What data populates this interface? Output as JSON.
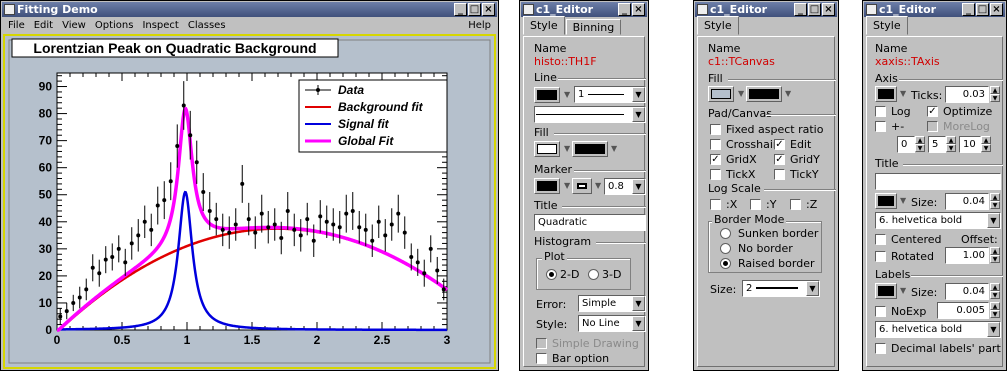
{
  "main_window": {
    "title": "Fitting Demo",
    "menu": [
      "File",
      "Edit",
      "View",
      "Options",
      "Inspect",
      "Classes"
    ],
    "help": "Help"
  },
  "plot": {
    "title": "Lorentzian Peak on Quadratic Background",
    "legend": [
      "Data",
      "Background fit",
      "Signal fit",
      "Global Fit"
    ],
    "colors": {
      "data": "#000000",
      "background": "#e00000",
      "signal": "#0000dd",
      "global": "#ff00ff",
      "frame": "#d6d600",
      "canvas": "#b5c0cc"
    }
  },
  "chart_data": {
    "type": "scatter",
    "title": "Lorentzian Peak on Quadratic Background",
    "xlabel": "",
    "ylabel": "",
    "xlim": [
      0,
      3
    ],
    "ylim": [
      0,
      95
    ],
    "xticks": [
      "0",
      "0.5",
      "1",
      "1.5",
      "2",
      "2.5",
      "3"
    ],
    "yticks": [
      "0",
      "10",
      "20",
      "30",
      "40",
      "50",
      "60",
      "70",
      "80",
      "90"
    ],
    "grid": false,
    "legend_position": "top-right",
    "series": [
      {
        "name": "Data",
        "type": "errorbar",
        "x": [
          0.025,
          0.075,
          0.125,
          0.175,
          0.225,
          0.275,
          0.325,
          0.375,
          0.425,
          0.475,
          0.525,
          0.575,
          0.625,
          0.675,
          0.725,
          0.775,
          0.825,
          0.875,
          0.925,
          0.975,
          1.025,
          1.075,
          1.125,
          1.175,
          1.225,
          1.275,
          1.325,
          1.375,
          1.425,
          1.475,
          1.525,
          1.575,
          1.625,
          1.675,
          1.725,
          1.775,
          1.825,
          1.875,
          1.925,
          1.975,
          2.025,
          2.075,
          2.125,
          2.175,
          2.225,
          2.275,
          2.325,
          2.375,
          2.425,
          2.475,
          2.525,
          2.575,
          2.625,
          2.675,
          2.725,
          2.775,
          2.825,
          2.875,
          2.925,
          2.975
        ],
        "y": [
          5,
          7,
          10,
          12,
          15,
          23,
          21,
          26,
          27,
          30,
          25,
          32,
          35,
          40,
          37,
          46,
          48,
          55,
          68,
          83,
          72,
          62,
          51,
          44,
          41,
          37,
          36,
          39,
          54,
          41,
          36,
          43,
          38,
          39,
          34,
          44,
          37,
          35,
          41,
          33,
          42,
          40,
          39,
          38,
          43,
          44,
          38,
          37,
          33,
          40,
          35,
          39,
          43,
          36,
          27,
          25,
          21,
          30,
          22,
          15
        ],
        "yerr": [
          3,
          3,
          3,
          4,
          4,
          5,
          5,
          5,
          5,
          5,
          5,
          6,
          6,
          6,
          6,
          7,
          7,
          7,
          8,
          9,
          9,
          8,
          7,
          7,
          6,
          6,
          6,
          6,
          7,
          6,
          6,
          7,
          6,
          6,
          6,
          7,
          6,
          6,
          6,
          6,
          6,
          6,
          6,
          6,
          7,
          7,
          6,
          6,
          6,
          6,
          6,
          6,
          7,
          6,
          5,
          5,
          5,
          5,
          5,
          4
        ]
      },
      {
        "name": "Background fit",
        "type": "line",
        "formula": "-0.78 + 45.1*x - 13.3*x^2"
      },
      {
        "name": "Signal fit",
        "type": "line",
        "formula": "Lorentzian amplitude 51, mean 0.987, width 0.13"
      },
      {
        "name": "Global Fit",
        "type": "line",
        "formula": "Background + Signal"
      }
    ]
  },
  "editor1": {
    "title": "c1_Editor",
    "tabs": [
      "Style",
      "Binning"
    ],
    "name_label": "Name",
    "name_value": "histo::TH1F",
    "line_label": "Line",
    "line_width": "1",
    "fill_label": "Fill",
    "marker_label": "Marker",
    "marker_size": "0.8",
    "title_label": "Title",
    "title_value": "Quadratic Background",
    "histogram_label": "Histogram",
    "plot_label": "Plot",
    "plot_2d": "2-D",
    "plot_3d": "3-D",
    "error_label": "Error:",
    "error_value": "Simple",
    "style_label": "Style:",
    "style_value": "No Line",
    "simple_drawing": "Simple Drawing",
    "bar_option": "Bar option"
  },
  "editor2": {
    "title": "c1_Editor",
    "tab": "Style",
    "name_label": "Name",
    "name_value": "c1::TCanvas",
    "fill_label": "Fill",
    "padcanvas_label": "Pad/Canvas",
    "fixed_aspect": "Fixed aspect ratio",
    "crosshair": "Crosshair",
    "edit": "Edit",
    "gridx": "GridX",
    "gridy": "GridY",
    "tickx": "TickX",
    "ticky": "TickY",
    "logscale_label": "Log Scale",
    "logx": ":X",
    "logy": ":Y",
    "logz": ":Z",
    "bordermode_label": "Border Mode",
    "sunken": "Sunken border",
    "noborder": "No border",
    "raised": "Raised border",
    "size_label": "Size:",
    "size_value": "2"
  },
  "editor3": {
    "title": "c1_Editor",
    "tab": "Style",
    "name_label": "Name",
    "name_value": "xaxis::TAxis",
    "axis_label": "Axis",
    "ticks_label": "Ticks:",
    "ticks_value": "0.03",
    "log": "Log",
    "optimize": "Optimize",
    "arrow": "+-",
    "morelog": "MoreLog",
    "div1": "0",
    "div2": "5",
    "div3": "10",
    "title_label": "Title",
    "title_value": "",
    "title_size_label": "Size:",
    "title_size": "0.04",
    "title_font": "6. helvetica bold",
    "centered": "Centered",
    "offset_label": "Offset:",
    "offset_value": "1.00",
    "rotated": "Rotated",
    "labels_label": "Labels",
    "label_size_label": "Size:",
    "label_size": "0.04",
    "noexp": "NoExp",
    "noexp_value": "0.005",
    "label_font": "6. helvetica bold",
    "decimal": "Decimal labels' part"
  }
}
